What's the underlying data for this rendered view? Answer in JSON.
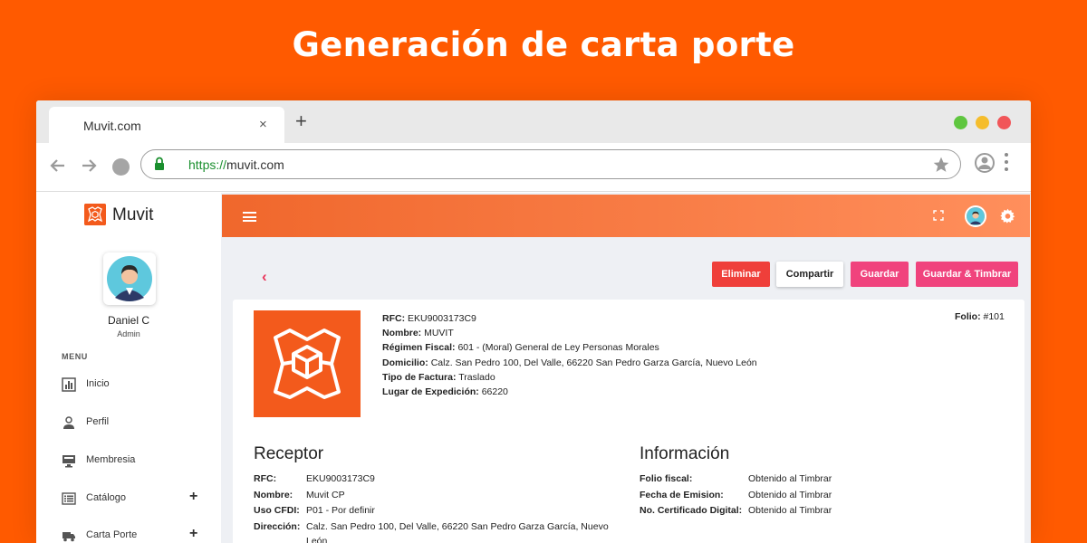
{
  "headline": "Generación de carta porte",
  "browser": {
    "tab_title": "Muvit.com",
    "tab_close": "×",
    "tab_new": "+",
    "url_scheme": "https://",
    "url_rest": "muvit.com",
    "window_dots": [
      "#5fc63f",
      "#f5bd2c",
      "#f15659"
    ]
  },
  "sidebar": {
    "brand": "Muvit",
    "user_name": "Daniel C",
    "user_role": "Admin",
    "menu_label": "MENU",
    "items": [
      {
        "label": "Inicio",
        "icon": "chart-icon"
      },
      {
        "label": "Perfil",
        "icon": "person-icon"
      },
      {
        "label": "Membresia",
        "icon": "monitor-icon"
      },
      {
        "label": "Catálogo",
        "icon": "list-icon",
        "expand": "+"
      },
      {
        "label": "Carta Porte",
        "icon": "truck-icon",
        "expand": "+"
      }
    ]
  },
  "toolbar": {
    "back": "‹",
    "delete_label": "Eliminar",
    "share_label": "Compartir",
    "save_label": "Guardar",
    "stamp_label": "Guardar & Timbrar"
  },
  "emisor": {
    "rfc_label": "RFC:",
    "rfc": "EKU9003173C9",
    "nombre_label": "Nombre:",
    "nombre": "MUVIT",
    "regimen_label": "Régimen Fiscal:",
    "regimen": "601 - (Moral) General de Ley Personas Morales",
    "domicilio_label": "Domicilio:",
    "domicilio": "Calz. San Pedro 100, Del Valle, 66220 San Pedro Garza García, Nuevo León",
    "tipo_label": "Tipo de Factura:",
    "tipo": "Traslado",
    "lugar_label": "Lugar de Expedición:",
    "lugar": "66220",
    "folio_label": "Folio:",
    "folio": "#101"
  },
  "receptor": {
    "title": "Receptor",
    "rows": [
      {
        "key": "RFC:",
        "value": "EKU9003173C9"
      },
      {
        "key": "Nombre:",
        "value": "Muvit CP"
      },
      {
        "key": "Uso CFDI:",
        "value": "P01 - Por definir"
      },
      {
        "key": "Dirección:",
        "value": "Calz. San Pedro 100, Del Valle, 66220 San Pedro Garza García, Nuevo",
        "value2": "León"
      }
    ]
  },
  "informacion": {
    "title": "Información",
    "rows": [
      {
        "key": "Folio fiscal:",
        "value": "Obtenido al Timbrar"
      },
      {
        "key": "Fecha de Emision:",
        "value": "Obtenido al Timbrar"
      },
      {
        "key": "No. Certificado Digital:",
        "value": "Obtenido al Timbrar"
      }
    ]
  }
}
